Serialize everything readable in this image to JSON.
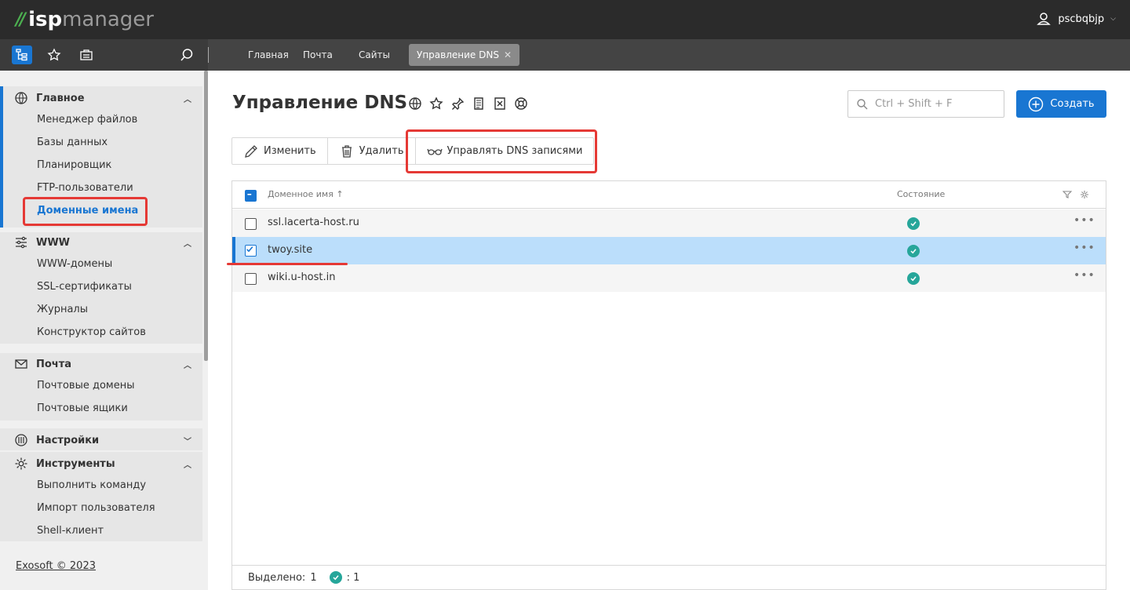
{
  "header": {
    "logo_part1": "isp",
    "logo_part2": "manager",
    "username": "pscbqbjp"
  },
  "tabs": [
    {
      "label": "Главная"
    },
    {
      "label": "Почта"
    },
    {
      "label": "Сайты"
    },
    {
      "label": "Управление DNS",
      "active": true
    }
  ],
  "sidebar": {
    "groups": [
      {
        "label": "Главное",
        "items": [
          "Менеджер файлов",
          "Базы данных",
          "Планировщик",
          "FTP-пользователи",
          "Доменные имена"
        ],
        "current": "Доменные имена"
      },
      {
        "label": "WWW",
        "items": [
          "WWW-домены",
          "SSL-сертификаты",
          "Журналы",
          "Конструктор сайтов"
        ]
      },
      {
        "label": "Почта",
        "items": [
          "Почтовые домены",
          "Почтовые ящики"
        ]
      },
      {
        "label": "Настройки",
        "items": []
      },
      {
        "label": "Инструменты",
        "items": [
          "Выполнить команду",
          "Импорт пользователя",
          "Shell-клиент"
        ]
      }
    ],
    "footer": "Exosoft © 2023"
  },
  "main": {
    "title": "Управление DNS",
    "search_placeholder": "Ctrl + Shift + F",
    "create_label": "Создать",
    "toolbar": {
      "edit": "Изменить",
      "delete": "Удалить",
      "manage_dns": "Управлять DNS записями"
    },
    "table": {
      "col_domain": "Доменное имя",
      "col_status": "Состояние",
      "rows": [
        {
          "domain": "ssl.lacerta-host.ru",
          "status": "ok",
          "selected": false
        },
        {
          "domain": "twoy.site",
          "status": "ok",
          "selected": true
        },
        {
          "domain": "wiki.u-host.in",
          "status": "ok",
          "selected": false
        }
      ],
      "footer_selected_label": "Выделено:",
      "footer_selected_count": "1",
      "footer_ok_count": ": 1"
    }
  },
  "colors": {
    "accent": "#1976d2",
    "highlight": "#e53935",
    "ok": "#26a69a"
  }
}
